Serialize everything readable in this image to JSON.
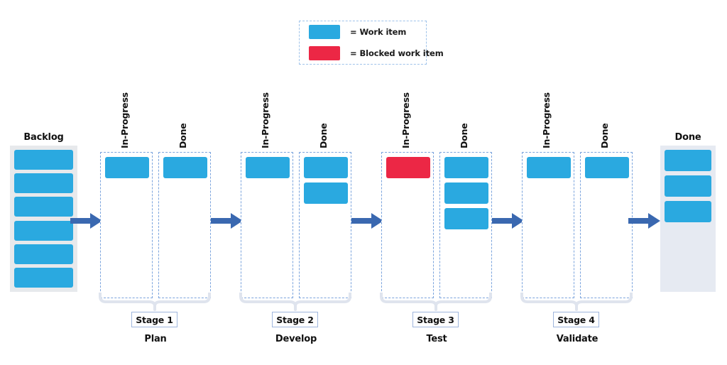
{
  "legend": {
    "items": [
      {
        "swatch": "work-item-swatch",
        "color": "#2aa9e0",
        "label": "= Work item"
      },
      {
        "swatch": "blocked-work-item-swatch",
        "color": "#ec2745",
        "label": "= Blocked work item"
      }
    ]
  },
  "colors": {
    "work_item": "#2aa9e0",
    "blocked_work_item": "#ec2745",
    "arrow": "#3a68b0",
    "lane_border": "#7ba4dd",
    "backlog_tray": "#e7e9ec",
    "done_tray": "#e6eaf2",
    "brace": "#dfe4ee",
    "badge_border": "#9fb6dd"
  },
  "backlog": {
    "title": "Backlog",
    "item_count": 6,
    "items": [
      {
        "state": "work"
      },
      {
        "state": "work"
      },
      {
        "state": "work"
      },
      {
        "state": "work"
      },
      {
        "state": "work"
      },
      {
        "state": "work"
      }
    ]
  },
  "stages": [
    {
      "badge": "Stage 1",
      "name": "Plan",
      "lanes": [
        {
          "title": "In-Progress",
          "items": [
            {
              "state": "work"
            }
          ]
        },
        {
          "title": "Done",
          "items": [
            {
              "state": "work"
            }
          ]
        }
      ]
    },
    {
      "badge": "Stage 2",
      "name": "Develop",
      "lanes": [
        {
          "title": "In-Progress",
          "items": [
            {
              "state": "work"
            }
          ]
        },
        {
          "title": "Done",
          "items": [
            {
              "state": "work"
            },
            {
              "state": "work"
            }
          ]
        }
      ]
    },
    {
      "badge": "Stage 3",
      "name": "Test",
      "lanes": [
        {
          "title": "In-Progress",
          "items": [
            {
              "state": "blocked"
            }
          ]
        },
        {
          "title": "Done",
          "items": [
            {
              "state": "work"
            },
            {
              "state": "work"
            },
            {
              "state": "work"
            }
          ]
        }
      ]
    },
    {
      "badge": "Stage 4",
      "name": "Validate",
      "lanes": [
        {
          "title": "In-Progress",
          "items": [
            {
              "state": "work"
            }
          ]
        },
        {
          "title": "Done",
          "items": [
            {
              "state": "work"
            }
          ]
        }
      ]
    }
  ],
  "final_done": {
    "title": "Done",
    "item_count": 3,
    "items": [
      {
        "state": "work"
      },
      {
        "state": "work"
      },
      {
        "state": "work"
      }
    ]
  },
  "arrows": {
    "count": 5,
    "direction": "right"
  }
}
